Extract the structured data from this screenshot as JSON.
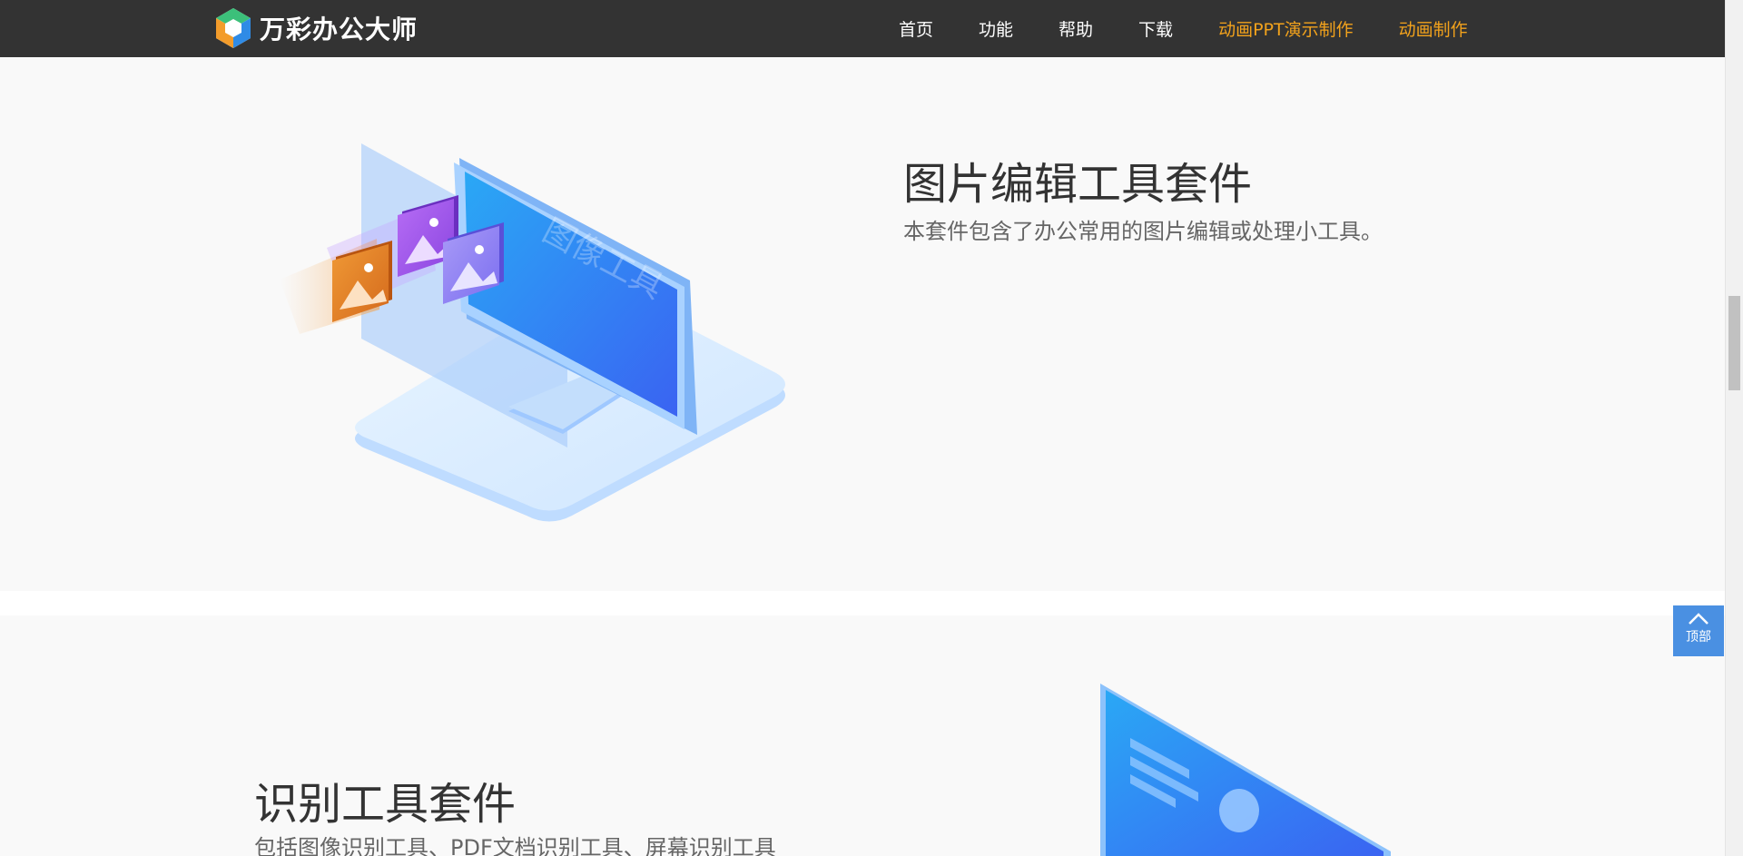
{
  "header": {
    "brand": "万彩办公大师",
    "nav": [
      {
        "label": "首页",
        "accent": false
      },
      {
        "label": "功能",
        "accent": false
      },
      {
        "label": "帮助",
        "accent": false
      },
      {
        "label": "下载",
        "accent": false
      },
      {
        "label": "动画PPT演示制作",
        "accent": true
      },
      {
        "label": "动画制作",
        "accent": true
      }
    ]
  },
  "sections": [
    {
      "title": "图片编辑工具套件",
      "description": "本套件包含了办公常用的图片编辑或处理小工具。",
      "illustration_text": "图像工具",
      "illustration_icon": "monitor-with-photos-illustration"
    },
    {
      "title": "识别工具套件",
      "description": "包括图像识别工具、PDF文档识别工具、屏幕识别工具",
      "illustration_icon": "document-screen-illustration"
    }
  ],
  "back_to_top": {
    "label": "顶部",
    "icon": "chevron-up-icon"
  },
  "colors": {
    "topbar": "#333333",
    "accent_nav": "#f2a21c",
    "section_bg": "#f9f9f9",
    "back_to_top_bg": "#4a90e2",
    "title_text": "#333333",
    "desc_text": "#666666"
  }
}
